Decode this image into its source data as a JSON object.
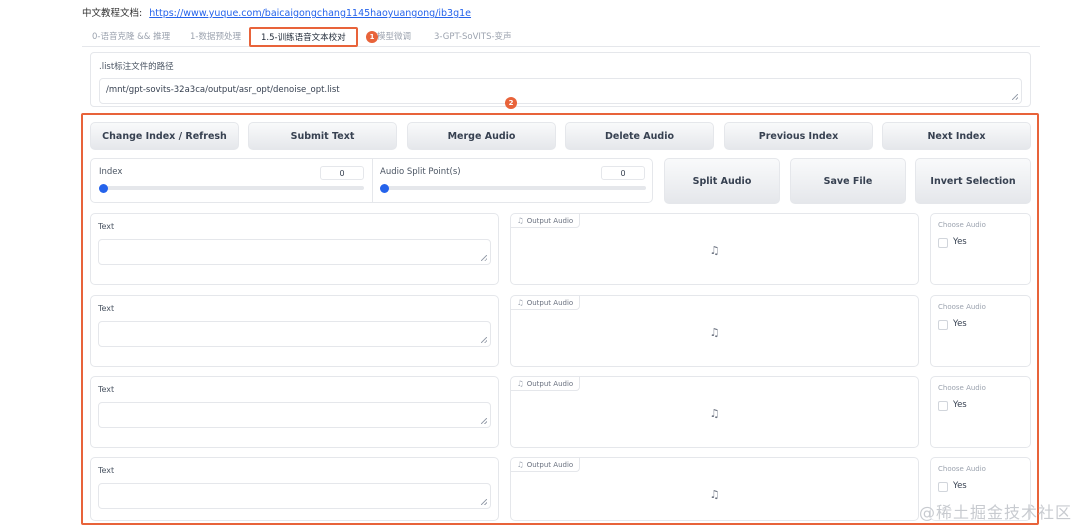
{
  "header": {
    "doc_label": "中文教程文档:",
    "doc_link": "https://www.yuque.com/baicaigongchang1145haoyuangong/ib3g1e"
  },
  "tabs": [
    {
      "label": "0-语音克隆 && 推理"
    },
    {
      "label": "1-数据预处理"
    },
    {
      "label": "1.5-训练语音文本校对"
    },
    {
      "label": "模型微调"
    },
    {
      "label": "3-GPT-SoVITS-变声"
    }
  ],
  "callouts": [
    "1",
    "2"
  ],
  "list_path": {
    "label": ".list标注文件的路径",
    "value": "/mnt/gpt-sovits-32a3ca/output/asr_opt/denoise_opt.list"
  },
  "toolbar": {
    "change_index": "Change Index / Refresh",
    "submit_text": "Submit Text",
    "merge_audio": "Merge Audio",
    "delete_audio": "Delete Audio",
    "previous_index": "Previous Index",
    "next_index": "Next Index"
  },
  "index_slider": {
    "label": "Index",
    "value": 0
  },
  "split_slider": {
    "label": "Audio Split Point(s)",
    "value": 0
  },
  "actions": {
    "split_audio": "Split Audio",
    "save_file": "Save File",
    "invert_selection": "Invert Selection"
  },
  "rows": [
    {
      "text_label": "Text",
      "audio_label": "Output Audio",
      "choose_label": "Choose Audio",
      "yes_label": "Yes"
    },
    {
      "text_label": "Text",
      "audio_label": "Output Audio",
      "choose_label": "Choose Audio",
      "yes_label": "Yes"
    },
    {
      "text_label": "Text",
      "audio_label": "Output Audio",
      "choose_label": "Choose Audio",
      "yes_label": "Yes"
    },
    {
      "text_label": "Text",
      "audio_label": "Output Audio",
      "choose_label": "Choose Audio",
      "yes_label": "Yes"
    }
  ],
  "watermark": "@稀土掘金技术社区",
  "colors": {
    "accent": "#e8633a",
    "slider": "#2563eb",
    "link": "#2563eb"
  }
}
